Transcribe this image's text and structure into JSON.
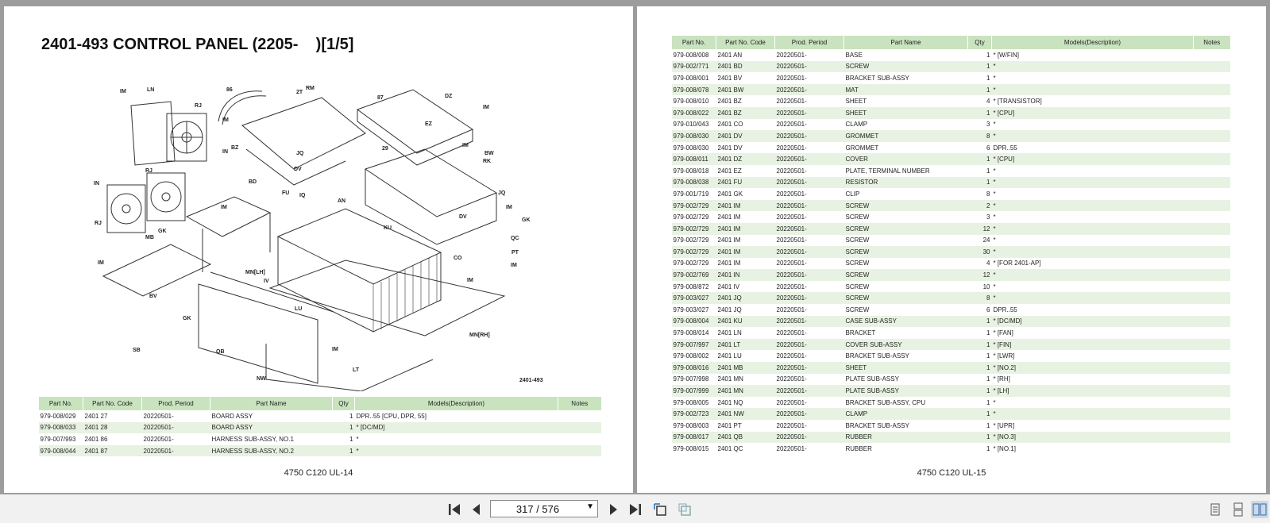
{
  "left_page": {
    "title": "2401-493 CONTROL PANEL (2205-    )[1/5]",
    "diagram_id": "2401-493",
    "footer": "4750 C120 UL-14",
    "callouts": [
      "IM",
      "LN",
      "RJ",
      "86",
      "2T",
      "RM",
      "87",
      "DZ",
      "IM",
      "IM",
      "EZ",
      "IN",
      "BZ",
      "JQ",
      "IM",
      "BW",
      "RK",
      "RJ",
      "IN",
      "BD",
      "FU",
      "DV",
      "IQ",
      "29",
      "JQ",
      "IM",
      "GK",
      "RJ",
      "IM",
      "AN",
      "KU",
      "DV",
      "GK",
      "QC",
      "GK",
      "MB",
      "IM",
      "PT",
      "IM",
      "CO",
      "MN[LH]",
      "IV",
      "IM",
      "BV",
      "GK",
      "LU",
      "MN[RH]",
      "SB",
      "QB",
      "IM",
      "NW",
      "LT"
    ],
    "table": {
      "headers": [
        "Part No.",
        "Part No. Code",
        "Prod. Period",
        "Part Name",
        "Qty",
        "Models(Description)",
        "Notes"
      ],
      "rows": [
        [
          "979-008/029",
          "2401 27",
          "20220501-",
          "BOARD ASSY",
          "1",
          "DPR..55 [CPU, DPR, 55]",
          ""
        ],
        [
          "979-008/033",
          "2401 28",
          "20220501-",
          "BOARD ASSY",
          "1",
          "* [DC/MD]",
          ""
        ],
        [
          "979-007/993",
          "2401 86",
          "20220501-",
          "HARNESS SUB-ASSY, NO.1",
          "1",
          "*",
          ""
        ],
        [
          "979-008/044",
          "2401 87",
          "20220501-",
          "HARNESS SUB-ASSY, NO.2",
          "1",
          "*",
          ""
        ]
      ]
    }
  },
  "right_page": {
    "footer": "4750 C120 UL-15",
    "table": {
      "headers": [
        "Part No.",
        "Part No. Code",
        "Prod. Period",
        "Part Name",
        "Qty",
        "Models(Description)",
        "Notes"
      ],
      "rows": [
        [
          "979-008/008",
          "2401 AN",
          "20220501-",
          "BASE",
          "1",
          "* [W/FIN]",
          ""
        ],
        [
          "979-002/771",
          "2401 BD",
          "20220501-",
          "SCREW",
          "1",
          "*",
          ""
        ],
        [
          "979-008/001",
          "2401 BV",
          "20220501-",
          "BRACKET SUB-ASSY",
          "1",
          "*",
          ""
        ],
        [
          "979-008/078",
          "2401 BW",
          "20220501-",
          "MAT",
          "1",
          "*",
          ""
        ],
        [
          "979-008/010",
          "2401 BZ",
          "20220501-",
          "SHEET",
          "4",
          "* [TRANSISTOR]",
          ""
        ],
        [
          "979-008/022",
          "2401 BZ",
          "20220501-",
          "SHEET",
          "1",
          "* [CPU]",
          ""
        ],
        [
          "979-010/043",
          "2401 CO",
          "20220501-",
          "CLAMP",
          "3",
          "*",
          ""
        ],
        [
          "979-008/030",
          "2401 DV",
          "20220501-",
          "GROMMET",
          "8",
          "*",
          ""
        ],
        [
          "979-008/030",
          "2401 DV",
          "20220501-",
          "GROMMET",
          "6",
          "DPR..55",
          ""
        ],
        [
          "979-008/011",
          "2401 DZ",
          "20220501-",
          "COVER",
          "1",
          "* [CPU]",
          ""
        ],
        [
          "979-008/018",
          "2401 EZ",
          "20220501-",
          "PLATE, TERMINAL NUMBER",
          "1",
          "*",
          ""
        ],
        [
          "979-008/038",
          "2401 FU",
          "20220501-",
          "RESISTOR",
          "1",
          "*",
          ""
        ],
        [
          "979-001/719",
          "2401 GK",
          "20220501-",
          "CLIP",
          "8",
          "*",
          ""
        ],
        [
          "979-002/729",
          "2401 IM",
          "20220501-",
          "SCREW",
          "2",
          "*",
          ""
        ],
        [
          "979-002/729",
          "2401 IM",
          "20220501-",
          "SCREW",
          "3",
          "*",
          ""
        ],
        [
          "979-002/729",
          "2401 IM",
          "20220501-",
          "SCREW",
          "12",
          "*",
          ""
        ],
        [
          "979-002/729",
          "2401 IM",
          "20220501-",
          "SCREW",
          "24",
          "*",
          ""
        ],
        [
          "979-002/729",
          "2401 IM",
          "20220501-",
          "SCREW",
          "30",
          "*",
          ""
        ],
        [
          "979-002/729",
          "2401 IM",
          "20220501-",
          "SCREW",
          "4",
          "* [FOR 2401-AP]",
          ""
        ],
        [
          "979-002/769",
          "2401 IN",
          "20220501-",
          "SCREW",
          "12",
          "*",
          ""
        ],
        [
          "979-008/872",
          "2401 IV",
          "20220501-",
          "SCREW",
          "10",
          "*",
          ""
        ],
        [
          "979-003/027",
          "2401 JQ",
          "20220501-",
          "SCREW",
          "8",
          "*",
          ""
        ],
        [
          "979-003/027",
          "2401 JQ",
          "20220501-",
          "SCREW",
          "6",
          "DPR..55",
          ""
        ],
        [
          "979-008/004",
          "2401 KU",
          "20220501-",
          "CASE SUB-ASSY",
          "1",
          "* [DC/MD]",
          ""
        ],
        [
          "979-008/014",
          "2401 LN",
          "20220501-",
          "BRACKET",
          "1",
          "* [FAN]",
          ""
        ],
        [
          "979-007/997",
          "2401 LT",
          "20220501-",
          "COVER SUB-ASSY",
          "1",
          "* [FIN]",
          ""
        ],
        [
          "979-008/002",
          "2401 LU",
          "20220501-",
          "BRACKET SUB-ASSY",
          "1",
          "* [LWR]",
          ""
        ],
        [
          "979-008/016",
          "2401 MB",
          "20220501-",
          "SHEET",
          "1",
          "* [NO.2]",
          ""
        ],
        [
          "979-007/998",
          "2401 MN",
          "20220501-",
          "PLATE SUB-ASSY",
          "1",
          "* [RH]",
          ""
        ],
        [
          "979-007/999",
          "2401 MN",
          "20220501-",
          "PLATE SUB-ASSY",
          "1",
          "* [LH]",
          ""
        ],
        [
          "979-008/005",
          "2401 NQ",
          "20220501-",
          "BRACKET SUB-ASSY, CPU",
          "1",
          "*",
          ""
        ],
        [
          "979-002/723",
          "2401 NW",
          "20220501-",
          "CLAMP",
          "1",
          "*",
          ""
        ],
        [
          "979-008/003",
          "2401 PT",
          "20220501-",
          "BRACKET SUB-ASSY",
          "1",
          "* [UPR]",
          ""
        ],
        [
          "979-008/017",
          "2401 QB",
          "20220501-",
          "RUBBER",
          "1",
          "* [NO.3]",
          ""
        ],
        [
          "979-008/015",
          "2401 QC",
          "20220501-",
          "RUBBER",
          "1",
          "* [NO.1]",
          ""
        ]
      ]
    }
  },
  "toolbar": {
    "page_indicator": "317 / 576",
    "icons": [
      "first-page-icon",
      "previous-page-icon",
      "next-page-icon",
      "last-page-icon",
      "rotate-page-icon",
      "fit-page-icon",
      "single-page-view-icon",
      "continuous-view-icon",
      "two-page-view-icon"
    ],
    "active_color": "#cfd8e4"
  }
}
